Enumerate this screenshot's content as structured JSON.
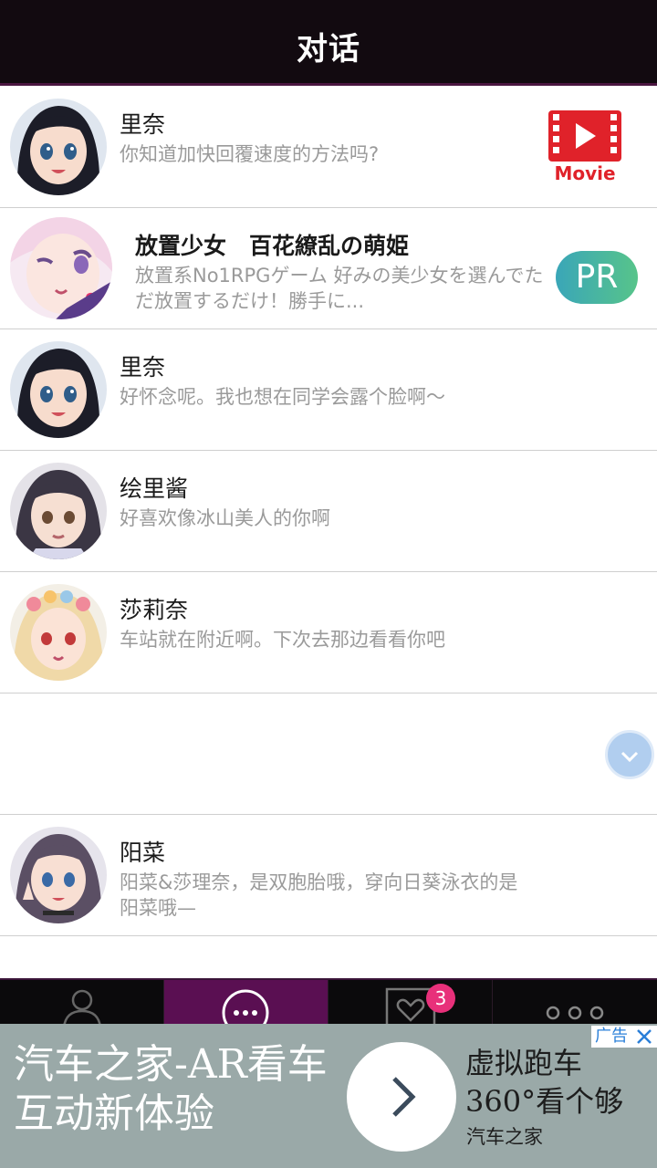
{
  "header": {
    "title": "对话"
  },
  "conversations": [
    {
      "name": "里奈",
      "message": "你知道加快回覆速度的方法吗?"
    },
    {
      "name": "放置少女　百花繚乱の萌姫",
      "message": "放置系No1RPGゲーム 好みの美少女を選んでただ放置するだけ！勝手に...",
      "badge": "PR"
    },
    {
      "name": "里奈",
      "message": "好怀念呢。我也想在同学会露个脸啊～"
    },
    {
      "name": "绘里酱",
      "message": "好喜欢像冰山美人的你啊"
    },
    {
      "name": "莎莉奈",
      "message": "车站就在附近啊。下次去那边看看你吧"
    },
    {
      "name": "阳菜",
      "message": "阳菜&莎理奈，是双胞胎哦，穿向日葵泳衣的是阳菜哦—"
    }
  ],
  "movie_icon": {
    "label": "Movie",
    "color": "#e0222a"
  },
  "tabbar": {
    "notification_count": "3",
    "active_color": "#5a0f52"
  },
  "ad": {
    "left_text": "汽车之家-AR看车互动新体验",
    "right_title": "虚拟跑车360°看个够",
    "right_sub": "汽车之家",
    "tag": "广告"
  }
}
